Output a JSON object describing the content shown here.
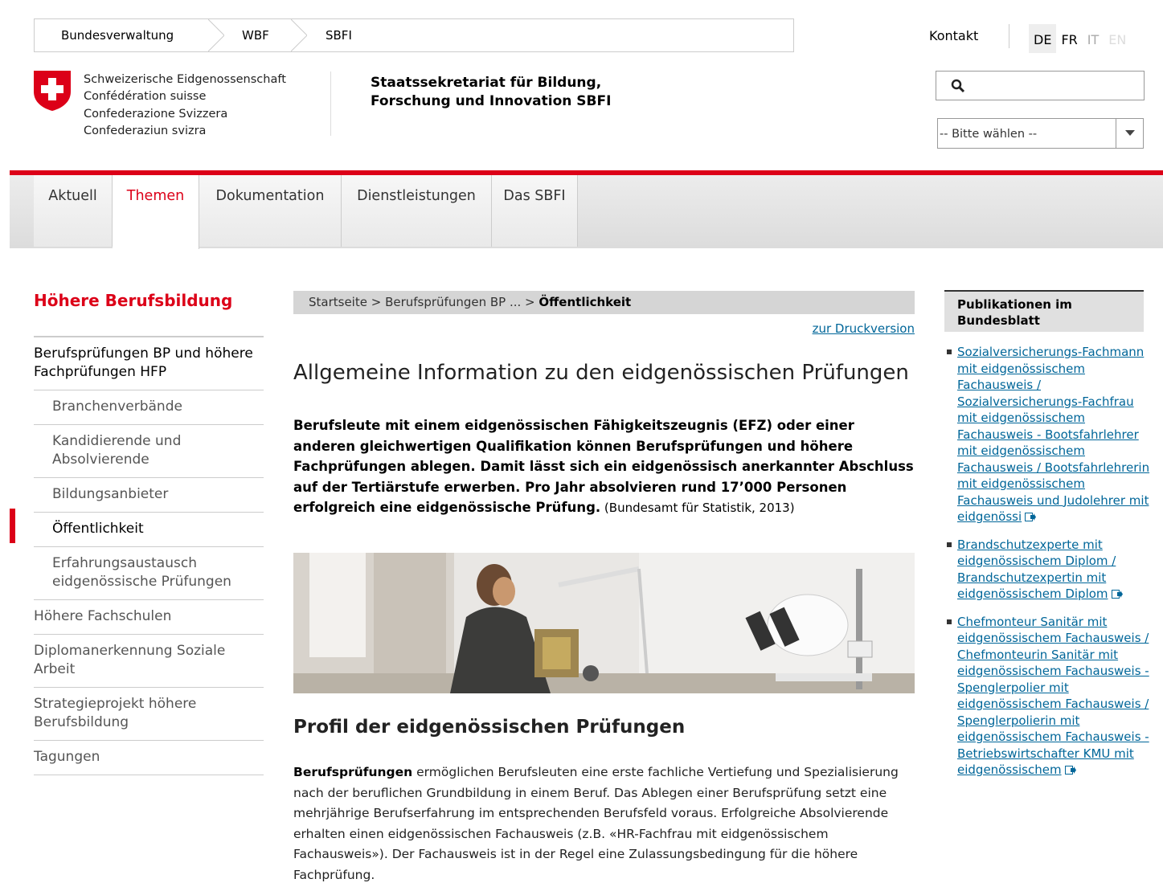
{
  "topbar": {
    "breadcrumb": [
      "Bundesverwaltung",
      "WBF",
      "SBFI"
    ],
    "kontakt": "Kontakt",
    "languages": [
      {
        "code": "DE",
        "state": "active"
      },
      {
        "code": "FR",
        "state": "normal"
      },
      {
        "code": "IT",
        "state": "muted"
      },
      {
        "code": "EN",
        "state": "faint"
      }
    ]
  },
  "logo": {
    "confed_lines": [
      "Schweizerische Eidgenossenschaft",
      "Confédération suisse",
      "Confederazione Svizzera",
      "Confederaziun svizra"
    ],
    "dept_lines": [
      "Staatssekretariat für Bildung,",
      "Forschung und Innovation SBFI"
    ]
  },
  "search": {
    "icon": "search-icon",
    "placeholder": ""
  },
  "select": {
    "value": "-- Bitte wählen --"
  },
  "nav": {
    "tabs": [
      "Aktuell",
      "Themen",
      "Dokumentation",
      "Dienstleistungen",
      "Das SBFI"
    ],
    "active": "Themen"
  },
  "sidebar": {
    "title": "Höhere Berufsbildung",
    "items": [
      {
        "label": "Berufsprüfungen BP und höhere Fachprüfungen HFP",
        "level": "top"
      },
      {
        "label": "Branchenverbände",
        "level": "sub"
      },
      {
        "label": "Kandidierende und Absolvierende",
        "level": "sub"
      },
      {
        "label": "Bildungsanbieter",
        "level": "sub"
      },
      {
        "label": "Öffentlichkeit",
        "level": "current"
      },
      {
        "label": "Erfahrungsaustausch eidgenössische Prüfungen",
        "level": "sub"
      },
      {
        "label": "Höhere Fachschulen",
        "level": "main"
      },
      {
        "label": "Diplomanerkennung Soziale Arbeit",
        "level": "main"
      },
      {
        "label": "Strategieprojekt höhere Berufsbildung",
        "level": "main"
      },
      {
        "label": "Tagungen",
        "level": "main"
      }
    ]
  },
  "main": {
    "breadcrumb_prefix": "Startseite > Berufsprüfungen BP ... > ",
    "breadcrumb_current": "Öffentlichkeit",
    "print_link": "zur Druckversion",
    "title": "Allgemeine Information zu den eidgenössischen Prüfungen",
    "lead_bold": "Berufsleute mit einem eidgenössischen Fähigkeitszeugnis (EFZ) oder einer anderen gleichwertigen Qualifikation können Berufsprüfungen und höhere Fachprüfungen ablegen. Damit lässt sich ein eidgenössisch anerkannter Abschluss auf der Tertiärstufe erwerben. Pro Jahr absolvieren rund 17’000 Personen erfolgreich eine eidgenössische Prüfung.",
    "lead_source": " (Bundesamt für Statistik, 2013)",
    "section_title": "Profil der eidgenössischen Prüfungen",
    "para_bold": "Berufsprüfungen",
    "para_text": " ermöglichen Berufsleuten eine erste fachliche Vertiefung und Spezialisierung nach der beruflichen Grundbildung in einem Beruf. Das Ablegen einer Berufsprüfung setzt eine mehrjährige Berufserfahrung im entsprechenden Berufsfeld voraus. Erfolgreiche Absolvierende erhalten einen eidgenössischen Fachausweis (z.B. «HR-Fachfrau mit eidgenössischem Fachausweis»). Der Fachausweis ist in der Regel eine Zulassungsbedingung für die höhere Fachprüfung."
  },
  "publications": {
    "title": "Publikationen im Bundesblatt",
    "items": [
      "Sozialversicherungs-Fachmann mit eidgenössischem Fachausweis / Sozialversicherungs-Fachfrau mit eidgenössischem Fachausweis - Bootsfahrlehrer mit eidgenössischem Fachausweis / Bootsfahrlehrerin mit eidgenössischem Fachausweis und Judolehrer mit eidgenössi",
      "Brandschutzexperte mit eidgenössischem Diplom / Brandschutzexpertin mit eidgenössischem Diplom",
      "Chefmonteur Sanitär mit eidgenössischem Fachausweis / Chefmonteurin Sanitär mit eidgenössischem Fachausweis - Spenglerpolier mit eidgenössischem Fachausweis / Spenglerpolierin mit eidgenössischem Fachausweis - Betriebswirtschafter KMU mit eidgenössischem"
    ]
  },
  "colors": {
    "accent": "#dc0018",
    "link": "#006699"
  }
}
